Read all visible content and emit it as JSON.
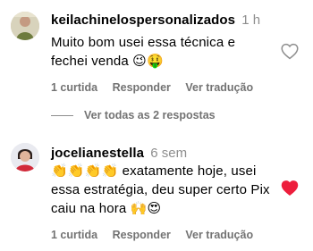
{
  "comments": [
    {
      "username": "keilachinelospersonalizados",
      "time": "1 h",
      "text_lines": [
        "Muito bom usei essa técnica e",
        "fechei venda 😉🤑"
      ],
      "likes": "1 curtida",
      "reply_label": "Responder",
      "translate_label": "Ver tradução",
      "liked": false
    },
    {
      "username": "jocelianestella",
      "time": "6 sem",
      "text_lines": [
        "👏👏👏👏 exatamente hoje, usei",
        "essa estratégia, deu super certo Pix",
        "caiu na hora 🙌😍"
      ],
      "likes": "1 curtida",
      "reply_label": "Responder",
      "translate_label": "Ver tradução",
      "liked": true
    }
  ],
  "view_replies": "Ver todas as 2 respostas",
  "colors": {
    "heart_liked": "#ed1e3c",
    "muted_text": "#737373",
    "heart_outline": "#262626"
  }
}
